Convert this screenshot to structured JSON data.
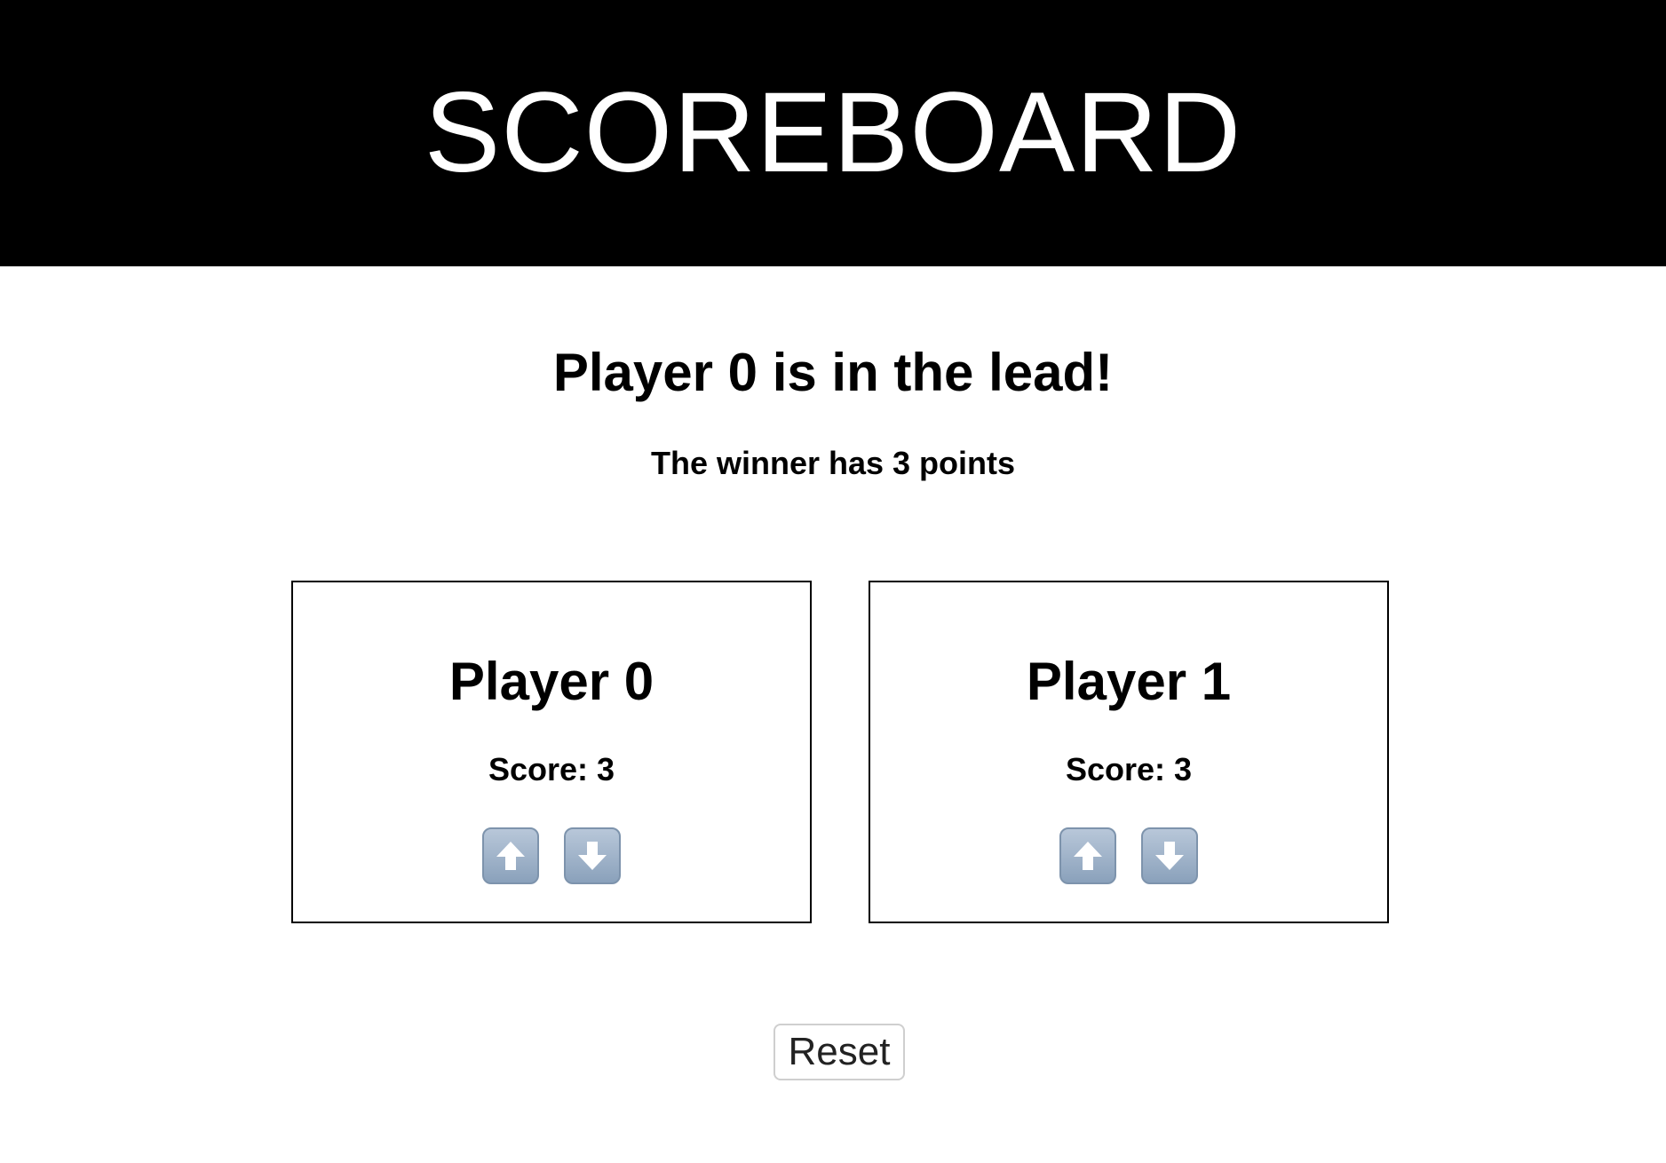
{
  "header": {
    "title": "SCOREBOARD"
  },
  "status": {
    "lead_message": "Player 0 is in the lead!",
    "winner_message": "The winner has 3 points"
  },
  "players": [
    {
      "name": "Player 0",
      "score_text": "Score: 3",
      "score": 3,
      "controls": {
        "up_icon": "up-arrow-icon",
        "down_icon": "down-arrow-icon"
      }
    },
    {
      "name": "Player 1",
      "score_text": "Score: 3",
      "score": 3,
      "controls": {
        "up_icon": "up-arrow-icon",
        "down_icon": "down-arrow-icon"
      }
    }
  ],
  "actions": {
    "reset_label": "Reset"
  },
  "colors": {
    "header_background": "#000000",
    "header_text": "#ffffff",
    "page_background": "#ffffff",
    "card_border": "#000000",
    "arrow_button": "#8aa1bb"
  }
}
